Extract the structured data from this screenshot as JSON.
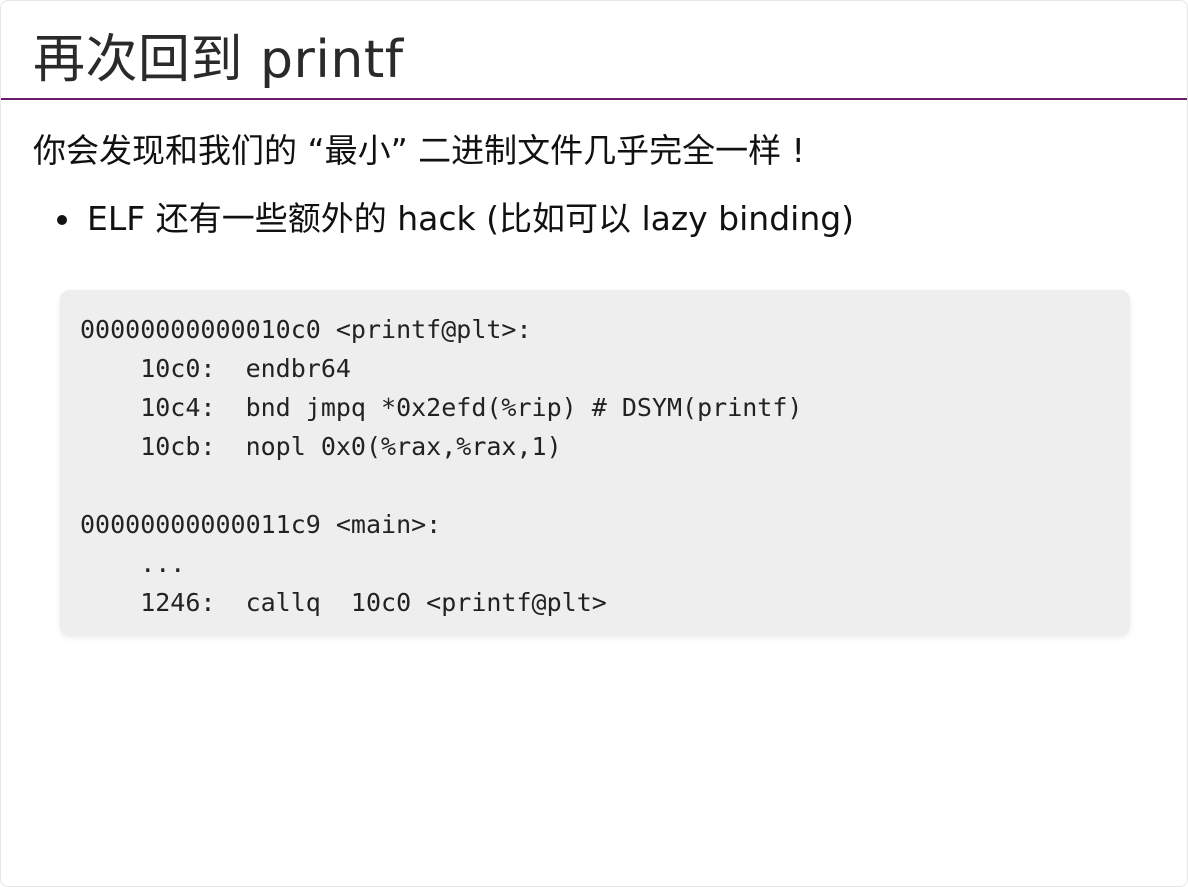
{
  "slide": {
    "title": "再次回到 printf",
    "intro": "你会发现和我们的 “最小” 二进制文件几乎完全一样 !",
    "bullets": [
      "ELF 还有一些额外的 hack (比如可以 lazy binding)"
    ],
    "code_lines": [
      "00000000000010c0 <printf@plt>:",
      "    10c0:  endbr64",
      "    10c4:  bnd jmpq *0x2efd(%rip) # DSYM(printf)",
      "    10cb:  nopl 0x0(%rax,%rax,1)",
      "",
      "00000000000011c9 <main>:",
      "    ...",
      "    1246:  callq  10c0 <printf@plt>"
    ]
  },
  "colors": {
    "title_rule": "#6a1b6a",
    "code_background": "#eeeeee"
  }
}
